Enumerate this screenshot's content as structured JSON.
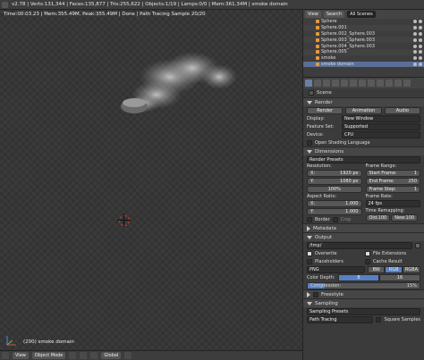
{
  "topbar": {
    "stats": "v2.78 | Verts:131,344 | Faces:135,877 | Tris:255,622 | Objects:1/19 | Lamps:0/0 | Mem:361.34M | smoke domain"
  },
  "viewport": {
    "status": "Time:00:03.23 | Mem:355.49M, Peak:355.49M | Done | Path Tracing Sample 20/20",
    "object_label": "(200) smoke domain"
  },
  "bottombar": {
    "mode": "Object Mode",
    "pivot": "Global"
  },
  "outliner": {
    "tabs": [
      "View",
      "Search",
      "All Scenes"
    ],
    "items": [
      "Sphere",
      "Sphere.001",
      "Sphere.002_Sphere.003",
      "Sphere.003_Sphere.003",
      "Sphere.004_Sphere.003",
      "Sphere.005",
      "smoke",
      "smoke domain"
    ]
  },
  "properties": {
    "scene_label": "Scene",
    "render": {
      "panel_title": "Render",
      "buttons": [
        "Render",
        "Animation",
        "Audio"
      ],
      "display_label": "Display:",
      "display_value": "New Window",
      "feature_label": "Feature Set:",
      "feature_value": "Supported",
      "device_label": "Device:",
      "device_value": "CPU",
      "osl_label": "Open Shading Language"
    },
    "dimensions": {
      "panel_title": "Dimensions",
      "presets": "Render Presets",
      "resolution_label": "Resolution:",
      "res_x": [
        "X:",
        "1920 px"
      ],
      "res_y": [
        "Y:",
        "1080 px"
      ],
      "res_pct": "100%",
      "frame_range_label": "Frame Range:",
      "start": [
        "Start Frame:",
        "1"
      ],
      "end": [
        "End Frame:",
        "250"
      ],
      "step": [
        "Frame Step:",
        "1"
      ],
      "aspect_label": "Aspect Ratio:",
      "aspect_x": [
        "X:",
        "1.000"
      ],
      "aspect_y": [
        "Y:",
        "1.000"
      ],
      "frame_rate_label": "Frame Rate:",
      "fps": "24 fps",
      "time_remap_label": "Time Remapping:",
      "old": "Old:100",
      "new": "New:100",
      "border": "Border",
      "crop": "Crop"
    },
    "metadata": {
      "panel_title": "Metadata"
    },
    "output": {
      "panel_title": "Output",
      "path": "/tmp/",
      "overwrite": "Overwrite",
      "file_ext": "File Extensions",
      "placeholders": "Placeholders",
      "cache_result": "Cache Result",
      "format": "PNG",
      "color_modes": [
        "BW",
        "RGB",
        "RGBA"
      ],
      "color_depth_label": "Color Depth:",
      "depths": [
        "8",
        "16"
      ],
      "compression_label": "Compression:",
      "compression_value": "15%",
      "compression_fraction": 0.15
    },
    "freestyle": {
      "panel_title": "Freestyle"
    },
    "sampling": {
      "panel_title": "Sampling",
      "presets": "Sampling Presets",
      "method": "Path Tracing",
      "square": "Square Samples"
    }
  },
  "colors": {
    "accent": "#5680c2",
    "object_icon": "#e89a3c"
  }
}
